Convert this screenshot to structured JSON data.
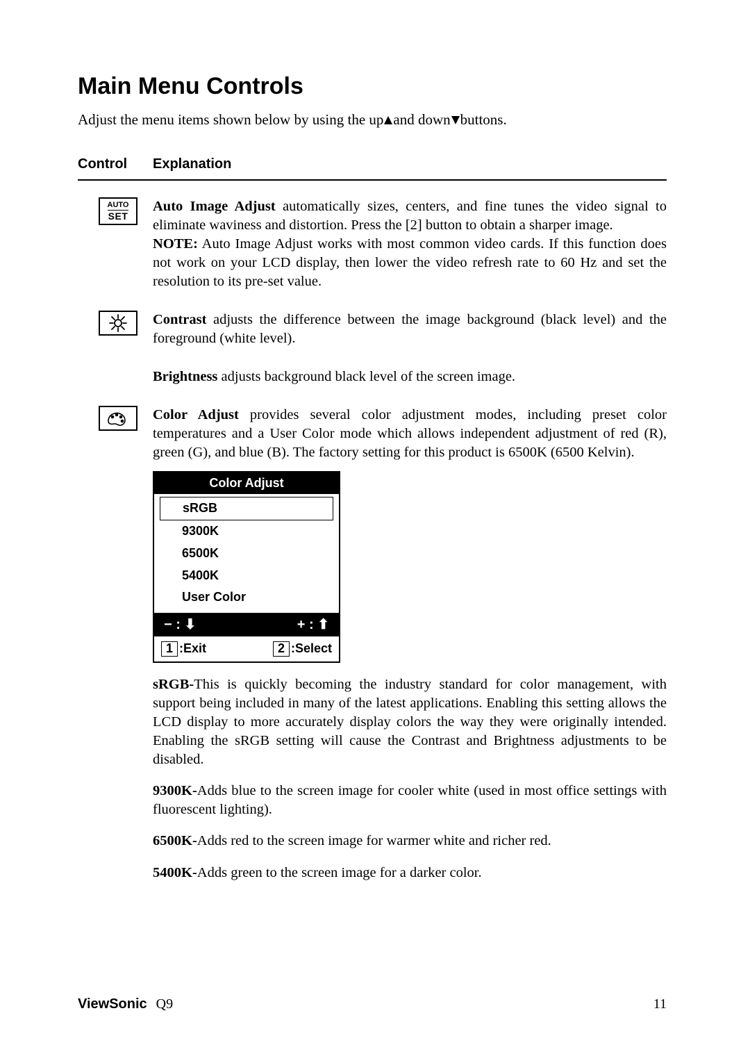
{
  "title": "Main Menu Controls",
  "intro_pre": "Adjust the menu items shown below by using the up",
  "intro_mid": "and down",
  "intro_post": "buttons.",
  "header": {
    "control": "Control",
    "explanation": "Explanation"
  },
  "autoSet": {
    "iconTop": "AUTO",
    "iconBottom": "SET",
    "lead": "Auto Image Adjust",
    "body": " automatically sizes, centers, and fine tunes the video signal to eliminate waviness and distortion. Press the [2] button to obtain a sharper image.",
    "noteLead": "NOTE:",
    "noteBody": " Auto Image Adjust works with most common video cards. If this function does not work on your LCD display, then lower the video refresh rate to 60 Hz and set the resolution to its pre-set value."
  },
  "contrast": {
    "lead": "Contrast",
    "body": " adjusts the difference between the image background  (black level) and the foreground (white level)."
  },
  "brightness": {
    "lead": "Brightness",
    "body": " adjusts background black level of the screen image."
  },
  "colorAdjust": {
    "lead": "Color Adjust",
    "body": " provides several color adjustment modes, including preset color temperatures and a User Color mode which allows independent adjustment of red (R), green (G), and blue (B). The factory setting for this product is 6500K (6500 Kelvin)."
  },
  "osd": {
    "title": "Color Adjust",
    "items": [
      "sRGB",
      "9300K",
      "6500K",
      "5400K",
      "User Color"
    ],
    "navMinus": "− :",
    "navPlus": "+ :",
    "exitKey": "1",
    "exitLabel": ":Exit",
    "selectKey": "2",
    "selectLabel": ":Select"
  },
  "srgb": {
    "lead": "sRGB-",
    "body": "This is quickly becoming the industry standard for color management, with support being included in many of the latest applications. Enabling this setting allows the LCD display to more accurately display colors the way they were originally intended. Enabling the sRGB setting will cause the Contrast and Brightness adjustments to be disabled."
  },
  "k9300": {
    "lead": "9300K-",
    "body": "Adds blue to the screen image for cooler white (used in most office settings with fluorescent lighting)."
  },
  "k6500": {
    "lead": "6500K-",
    "body": "Adds red to the screen image for warmer white and richer red."
  },
  "k5400": {
    "lead": "5400K-",
    "body": "Adds green to the screen image for a darker color."
  },
  "footer": {
    "brand": "ViewSonic",
    "model": "Q9",
    "page": "11"
  }
}
